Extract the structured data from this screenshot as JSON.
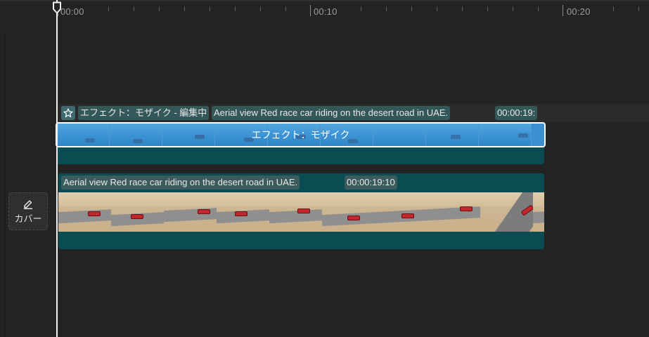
{
  "ruler": {
    "labels": [
      "00:00",
      "00:10",
      "00:20"
    ]
  },
  "cover": {
    "label": "カバー",
    "icon": "pen-icon"
  },
  "effect_track": {
    "icon": "effect-star-icon",
    "chip_effect_editing": "エフェクト：モザイク - 編集中",
    "chip_clip_title": "Aerial view Red race car riding on the desert road in UAE.",
    "chip_duration": "00:00:19:",
    "clip_label": "エフェクト：モザイク",
    "accent_color": "#3a8fd0"
  },
  "video_track": {
    "chip_clip_title": "Aerial view Red race car riding on the desert road in UAE.",
    "chip_duration": "00:00:19:10",
    "track_color": "#0b4c52"
  },
  "colors": {
    "background": "#232323",
    "playhead": "#f2f2f2"
  }
}
